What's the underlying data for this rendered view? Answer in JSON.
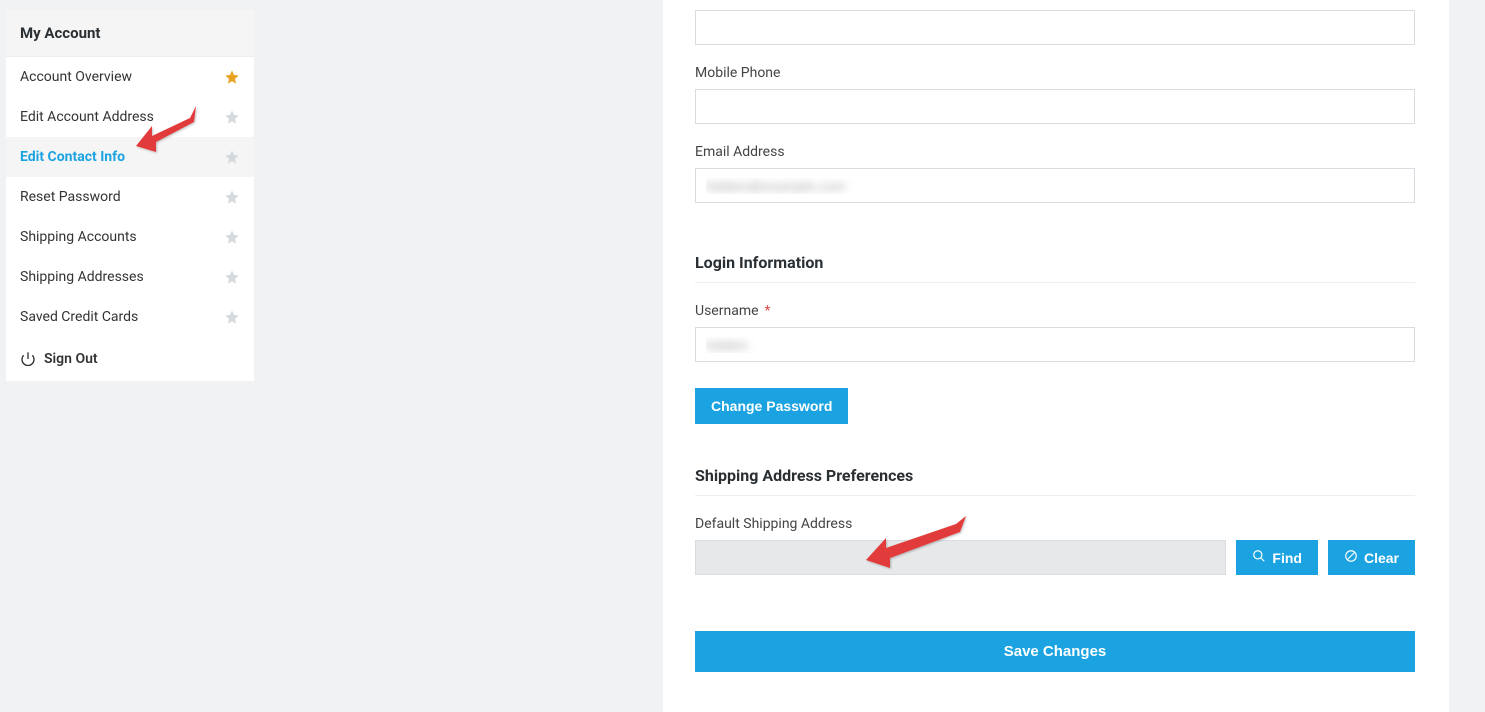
{
  "sidebar": {
    "title": "My Account",
    "items": [
      {
        "label": "Account Overview",
        "starred": true,
        "active": false
      },
      {
        "label": "Edit Account Address",
        "starred": false,
        "active": false
      },
      {
        "label": "Edit Contact Info",
        "starred": false,
        "active": true
      },
      {
        "label": "Reset Password",
        "starred": false,
        "active": false
      },
      {
        "label": "Shipping Accounts",
        "starred": false,
        "active": false
      },
      {
        "label": "Shipping Addresses",
        "starred": false,
        "active": false
      },
      {
        "label": "Saved Credit Cards",
        "starred": false,
        "active": false
      }
    ],
    "signout": "Sign Out"
  },
  "form": {
    "top_field_value": "",
    "mobile_label": "Mobile Phone",
    "mobile_value": "",
    "email_label": "Email Address",
    "email_value": "hidden@example.com",
    "login_section": "Login Information",
    "username_label": "Username",
    "username_value": "hidden",
    "change_pw": "Change Password",
    "ship_section": "Shipping Address Preferences",
    "default_ship_label": "Default Shipping Address",
    "default_ship_value": "",
    "find": "Find",
    "clear": "Clear",
    "save": "Save Changes"
  }
}
